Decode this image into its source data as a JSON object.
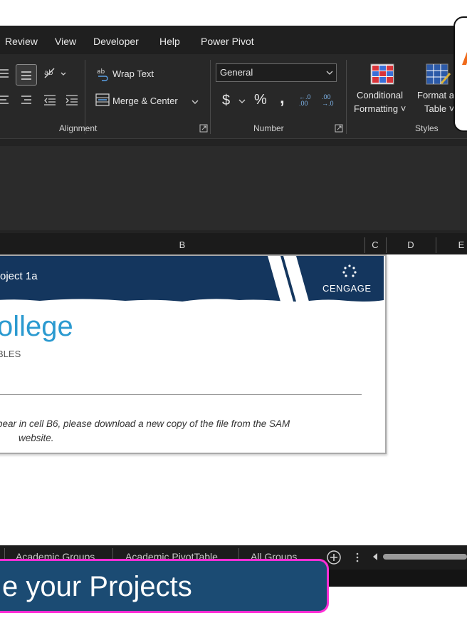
{
  "menu": [
    "Review",
    "View",
    "Developer",
    "Help",
    "Power Pivot"
  ],
  "ribbon": {
    "wrap_text": "Wrap Text",
    "merge_center": "Merge & Center",
    "number_format": "General",
    "currency": "$",
    "percent": "%",
    "comma": ",",
    "increase_decimal": "←.0 .00",
    "decrease_decimal": ".00 →.0",
    "conditional_formatting_l1": "Conditional",
    "conditional_formatting_l2": "Formatting ˅",
    "format_table_l1": "Format a",
    "format_table_l2": "Table ˅",
    "groups": [
      "Alignment",
      "Number",
      "Styles"
    ]
  },
  "columns": [
    "B",
    "C",
    "D",
    "E"
  ],
  "sheet": {
    "project_label": "oject 1a",
    "cengage": "CENGAGE",
    "college_title": "ollege",
    "subtitle": "BLES",
    "notice_line1": "pear in cell B6, please download a new copy of the file from the SAM",
    "notice_line2": "website."
  },
  "tabs": [
    "Academic Groups",
    "Academic PivotTable",
    "All Groups"
  ],
  "promo": "e your Projects",
  "colors": {
    "banner_navy": "#14365e",
    "college_blue": "#2b9ad0",
    "promo_bg": "#1b4b73",
    "promo_border": "#ff2fd6",
    "callout_orange": "#f06a1a"
  }
}
